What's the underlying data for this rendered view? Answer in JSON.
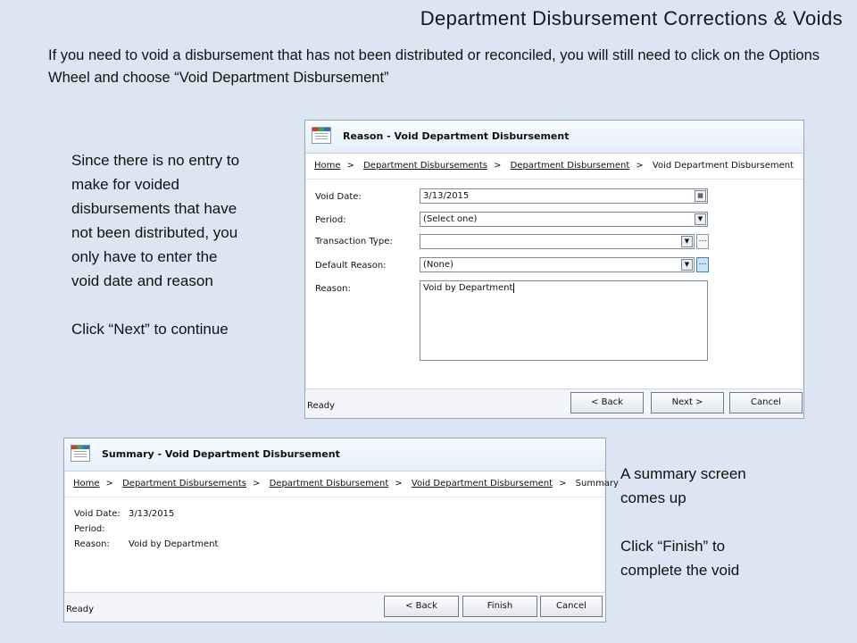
{
  "slide": {
    "title": "Department Disbursement Corrections & Voids",
    "intro": "If you need to void a disbursement that has not been distributed or reconciled, you will still need to click on the Options Wheel and choose “Void Department Disbursement”",
    "note_left": [
      "Since there is no entry to",
      "make for voided",
      "disbursements that have",
      "not been distributed, you",
      "only have to enter the",
      "void date and reason"
    ],
    "note_left_action": "Click “Next” to continue",
    "note_right": [
      "A summary screen",
      "comes up"
    ],
    "note_right_action": [
      "Click “Finish” to",
      "complete the void"
    ]
  },
  "reason_dialog": {
    "title": "Reason - Void Department Disbursement",
    "breadcrumb": [
      "Home",
      "Department Disbursements",
      "Department Disbursement",
      "Void Department Disbursement"
    ],
    "void_date_label": "Void Date:",
    "void_date_value": "3/13/2015",
    "period_label": "Period:",
    "period_value": "(Select one)",
    "transaction_type_label": "Transaction Type:",
    "transaction_type_value": "",
    "default_reason_label": "Default Reason:",
    "default_reason_value": "(None)",
    "reason_label": "Reason:",
    "reason_value": "Void by Department",
    "status": "Ready",
    "back_label": "< Back",
    "next_label": "Next >",
    "cancel_label": "Cancel"
  },
  "summary_dialog": {
    "title": "Summary - Void Department Disbursement",
    "breadcrumb": [
      "Home",
      "Department Disbursements",
      "Department Disbursement",
      "Void Department Disbursement",
      "Summary"
    ],
    "void_date_label": "Void Date:",
    "void_date_value": "3/13/2015",
    "period_label": "Period:",
    "period_value": "",
    "reason_label": "Reason:",
    "reason_value": "Void by Department",
    "status": "Ready",
    "back_label": "< Back",
    "finish_label": "Finish",
    "cancel_label": "Cancel"
  },
  "icons": {
    "dropdown": "chevron-down-icon",
    "calendar": "calendar-icon",
    "lookup": "ellipsis-icon"
  }
}
